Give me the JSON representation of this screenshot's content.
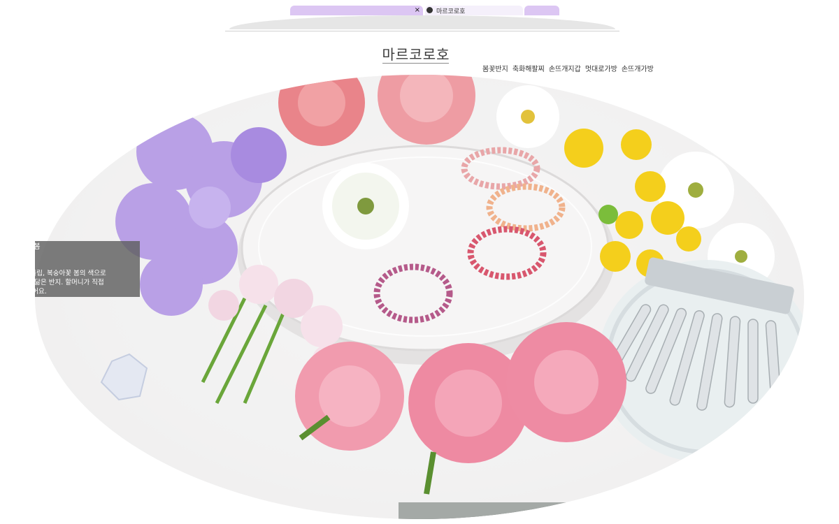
{
  "browser": {
    "tabs": [
      {
        "label": "",
        "active": true
      },
      {
        "label": "마르코로호",
        "active": false
      }
    ],
    "close_symbol": "×"
  },
  "site": {
    "logo": "마르코로호",
    "nav": [
      "봄꽃반지",
      "축화해팔찌",
      "손뜨개지갑",
      "멋대로가방",
      "손뜨개가방"
    ]
  },
  "caption": {
    "title": "에 봄\n리",
    "text": "벚꽃, 튤립, 복숭아꽃 봄의 색으로\n꽃잎을 닮은 반지. 할머니가 직접\n만들었어요."
  },
  "colors": {
    "tab_active": "#dcc6f3",
    "caption_bg": "#5f5f5f",
    "hero_bg": "#f2f1f1",
    "bottom_band": "#2f3a33"
  },
  "icons": {
    "tab_favicon": "globe-icon",
    "tab_close": "close-icon"
  }
}
